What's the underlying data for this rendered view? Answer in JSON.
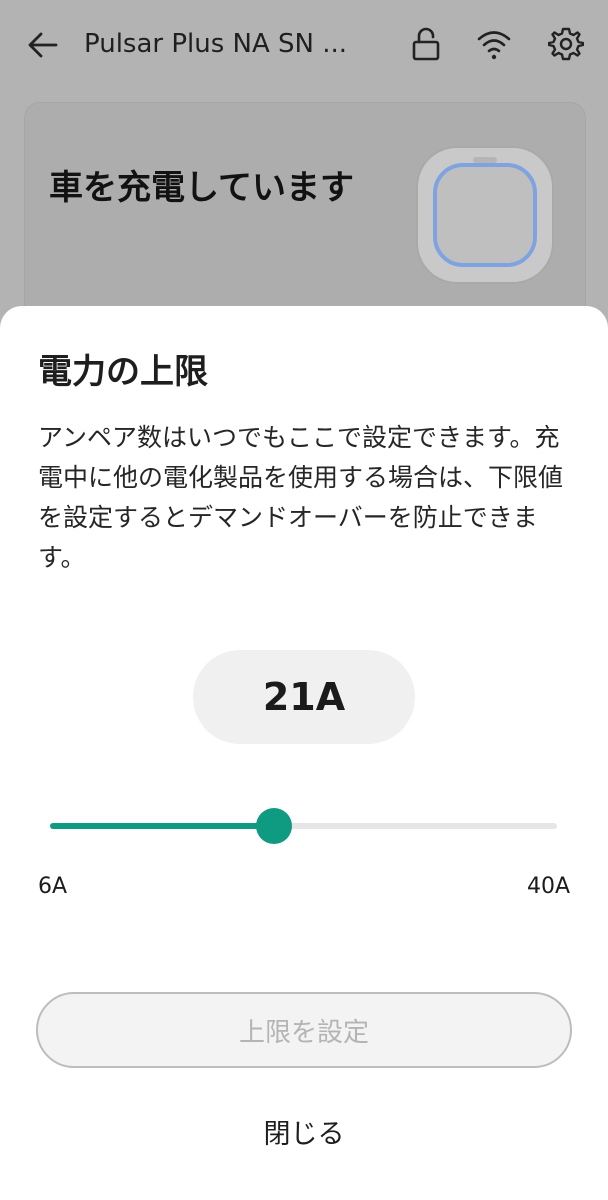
{
  "app_bar": {
    "title": "Pulsar Plus NA SN ...",
    "back_icon": "arrow-left-icon",
    "lock_icon": "lock-icon",
    "wifi_icon": "wifi-icon",
    "settings_icon": "gear-icon"
  },
  "status_card": {
    "status_text": "車を充電しています",
    "charger_icon": "charger-device-icon"
  },
  "sheet": {
    "title": "電力の上限",
    "description": "アンペア数はいつでもここで設定できます。充電中に他の電化製品を使用する場合は、下限値を設定するとデマンドオーバーを防止できます。",
    "current_value": "21A",
    "slider": {
      "min_label": "6A",
      "max_label": "40A",
      "min": 6,
      "max": 40,
      "value": 21
    },
    "set_button_label": "上限を設定",
    "close_button_label": "閉じる"
  },
  "colors": {
    "accent": "#0f9a82",
    "scrim": "#b3b3b3",
    "charger_ring": "#7fa3e0"
  }
}
